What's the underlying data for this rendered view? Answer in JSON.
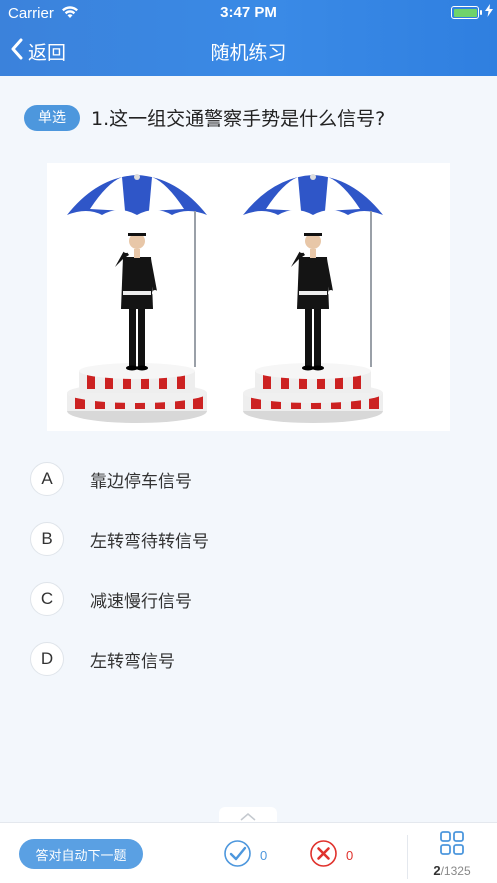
{
  "status_bar": {
    "carrier": "Carrier",
    "time": "3:47 PM",
    "battery_level": 1.0
  },
  "nav": {
    "back_label": "返回",
    "title": "随机练习"
  },
  "question": {
    "type_label": "单选",
    "text": "1.这一组交通警察手势是什么信号?",
    "image_icon": "traffic-police-gesture-image",
    "options": [
      {
        "key": "A",
        "text": "靠边停车信号"
      },
      {
        "key": "B",
        "text": "左转弯待转信号"
      },
      {
        "key": "C",
        "text": "减速慢行信号"
      },
      {
        "key": "D",
        "text": "左转弯信号"
      }
    ]
  },
  "bottom": {
    "auto_next_label": "答对自动下一题",
    "correct_count": "0",
    "wrong_count": "0",
    "current": "2",
    "total_sep": "/1325"
  },
  "colors": {
    "header": "#3a85e0",
    "accent": "#4d97dd",
    "correct": "#4d97dd",
    "wrong": "#e0322d",
    "background": "#f3f7fc"
  }
}
